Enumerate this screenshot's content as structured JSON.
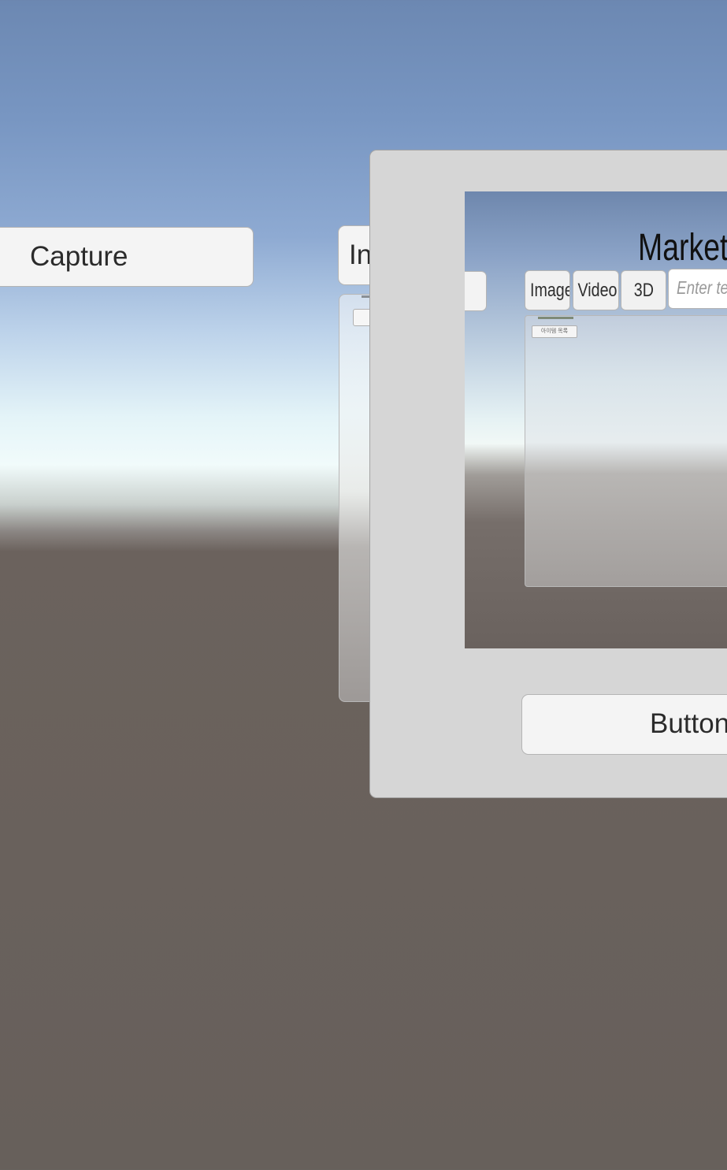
{
  "buttons": {
    "capture_label": "Capture",
    "back_button_label": "In",
    "popup_button_label": "Button"
  },
  "preview": {
    "title": "Market",
    "tabs": [
      {
        "label": "Image"
      },
      {
        "label": "Video"
      },
      {
        "label": "3D"
      }
    ],
    "search": {
      "placeholder": "Enter tex"
    },
    "list_item_label": "아이템 목록"
  }
}
